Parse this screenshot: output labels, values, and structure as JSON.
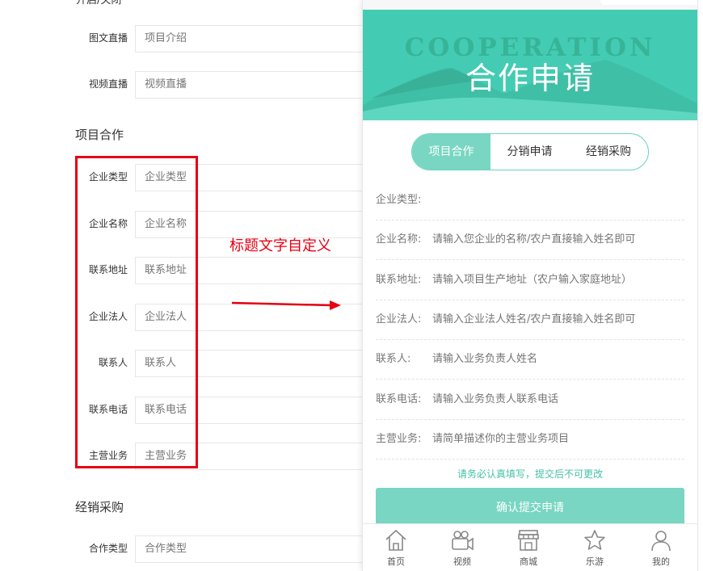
{
  "admin": {
    "cut_label": "开启/关闭",
    "top_fields": [
      {
        "label": "图文直播",
        "placeholder": "项目介绍"
      },
      {
        "label": "视频直播",
        "placeholder": "视频直播"
      }
    ],
    "section_cooperation": "项目合作",
    "cooperation_fields": [
      {
        "label": "企业类型",
        "placeholder": "企业类型"
      },
      {
        "label": "企业名称",
        "placeholder": "企业名称"
      },
      {
        "label": "联系地址",
        "placeholder": "联系地址"
      },
      {
        "label": "企业法人",
        "placeholder": "企业法人"
      },
      {
        "label": "联系人",
        "placeholder": "联系人"
      },
      {
        "label": "联系电话",
        "placeholder": "联系电话"
      },
      {
        "label": "主营业务",
        "placeholder": "主营业务"
      }
    ],
    "section_purchase": "经销采购",
    "purchase_fields": [
      {
        "label": "合作类型",
        "placeholder": "合作类型"
      }
    ],
    "annotation": "标题文字自定义",
    "highlight_color": "#e60012"
  },
  "phone": {
    "banner_sub": "COOPERATION",
    "banner_title": "合作申请",
    "tabs": [
      "项目合作",
      "分销申请",
      "经销采购"
    ],
    "active_tab": "项目合作",
    "fields": [
      {
        "label": "企业类型:",
        "placeholder": ""
      },
      {
        "label": "企业名称:",
        "placeholder": "请输入您企业的名称/农户直接输入姓名即可"
      },
      {
        "label": "联系地址:",
        "placeholder": "请输入项目生产地址（农户输入家庭地址）"
      },
      {
        "label": "企业法人:",
        "placeholder": "请输入企业法人姓名/农户直接输入姓名即可"
      },
      {
        "label": "联系人:",
        "placeholder": "请输入业务负责人姓名"
      },
      {
        "label": "联系电话:",
        "placeholder": "请输入业务负责人联系电话"
      },
      {
        "label": "主营业务:",
        "placeholder": "请简单描述你的主营业务项目"
      }
    ],
    "notice": "请务必认真填写，提交后不可更改",
    "submit_label": "确认提交申请",
    "tabbar": [
      {
        "label": "首页",
        "icon": "home-icon"
      },
      {
        "label": "视频",
        "icon": "video-camera-icon"
      },
      {
        "label": "商城",
        "icon": "store-icon"
      },
      {
        "label": "乐游",
        "icon": "star-icon"
      },
      {
        "label": "我的",
        "icon": "user-icon"
      }
    ],
    "accent_color": "#43ccb3",
    "button_color": "#78d6c2"
  }
}
